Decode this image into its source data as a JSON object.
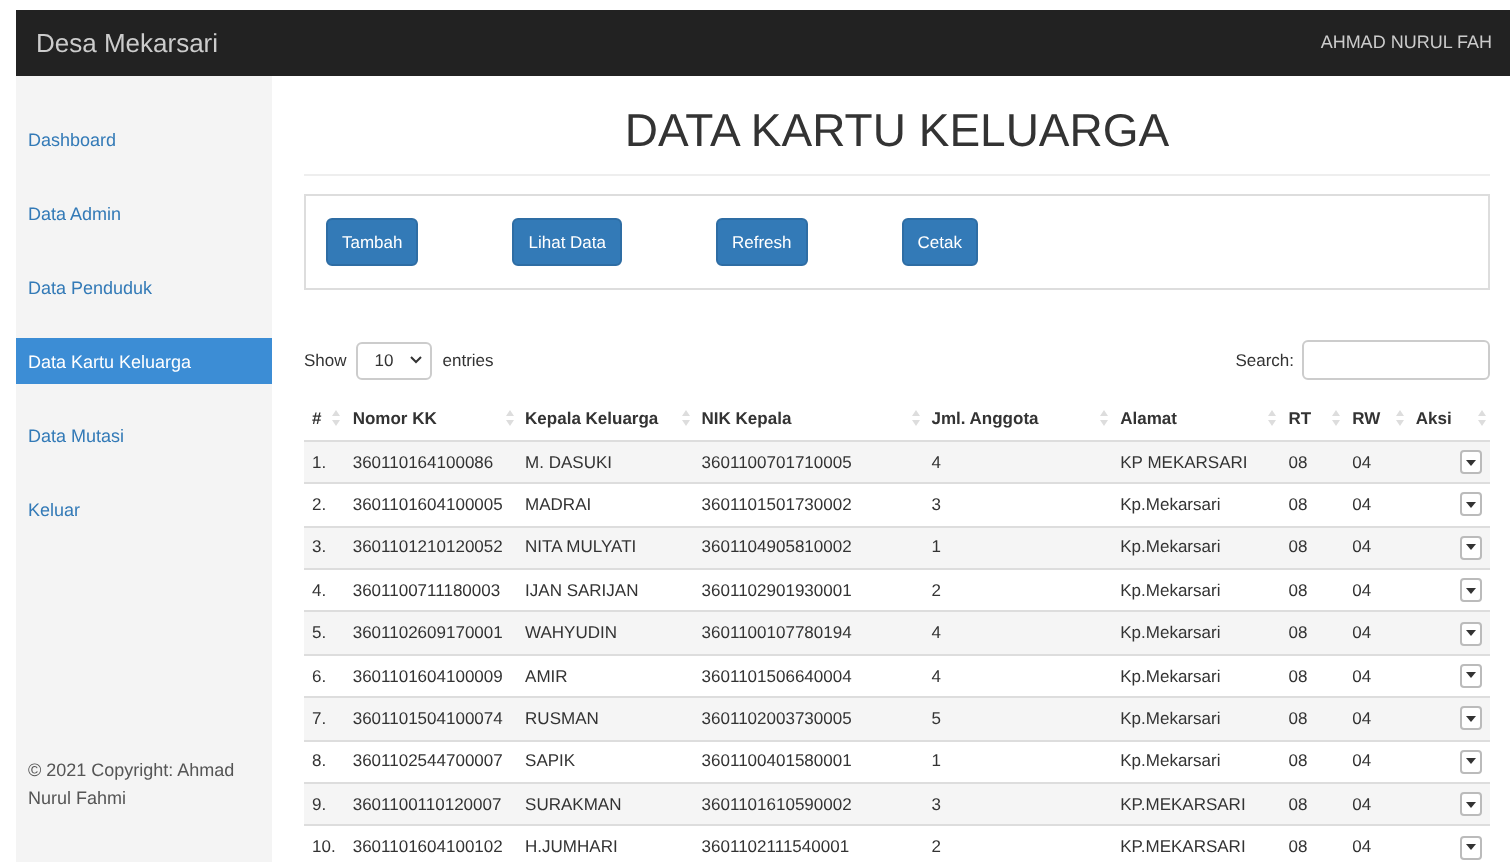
{
  "navbar": {
    "brand": "Desa Mekarsari",
    "user": "AHMAD NURUL FAH"
  },
  "sidebar": {
    "items": [
      {
        "label": "Dashboard",
        "selected": false
      },
      {
        "label": "Data Admin",
        "selected": false
      },
      {
        "label": "Data Penduduk",
        "selected": false
      },
      {
        "label": "Data Kartu Keluarga",
        "selected": true
      },
      {
        "label": "Data Mutasi",
        "selected": false
      },
      {
        "label": "Keluar",
        "selected": false
      }
    ],
    "footer": "© 2021 Copyright: Ahmad Nurul Fahmi"
  },
  "page_title": "DATA KARTU KELUARGA",
  "toolbar": [
    "Tambah",
    "Lihat Data",
    "Refresh",
    "Cetak"
  ],
  "length_menu": {
    "before": "Show",
    "value": "10",
    "after": "entries"
  },
  "search": {
    "label": "Search:"
  },
  "table": {
    "columns": [
      "#",
      "Nomor KK",
      "Kepala Keluarga",
      "NIK Kepala",
      "Jml. Anggota",
      "Alamat",
      "RT",
      "RW",
      "Aksi"
    ],
    "rows": [
      [
        "1.",
        "360110164100086",
        "M. DASUKI",
        "3601100701710005",
        "4",
        "KP MEKARSARI",
        "08",
        "04"
      ],
      [
        "2.",
        "3601101604100005",
        "MADRAI",
        "3601101501730002",
        "3",
        "Kp.Mekarsari",
        "08",
        "04"
      ],
      [
        "3.",
        "3601101210120052",
        "NITA MULYATI",
        "3601104905810002",
        "1",
        "Kp.Mekarsari",
        "08",
        "04"
      ],
      [
        "4.",
        "3601100711180003",
        "IJAN SARIJAN",
        "3601102901930001",
        "2",
        "Kp.Mekarsari",
        "08",
        "04"
      ],
      [
        "5.",
        "3601102609170001",
        "WAHYUDIN",
        "3601100107780194",
        "4",
        "Kp.Mekarsari",
        "08",
        "04"
      ],
      [
        "6.",
        "3601101604100009",
        "AMIR",
        "3601101506640004",
        "4",
        "Kp.Mekarsari",
        "08",
        "04"
      ],
      [
        "7.",
        "3601101504100074",
        "RUSMAN",
        "3601102003730005",
        "5",
        "Kp.Mekarsari",
        "08",
        "04"
      ],
      [
        "8.",
        "3601102544700007",
        "SAPIK",
        "3601100401580001",
        "1",
        "Kp.Mekarsari",
        "08",
        "04"
      ],
      [
        "9.",
        "3601100110120007",
        "SURAKMAN",
        "3601101610590002",
        "3",
        "KP.MEKARSARI",
        "08",
        "04"
      ],
      [
        "10.",
        "3601101604100102",
        "H.JUMHARI",
        "3601102111540001",
        "2",
        "KP.MEKARSARI",
        "08",
        "04"
      ]
    ]
  }
}
